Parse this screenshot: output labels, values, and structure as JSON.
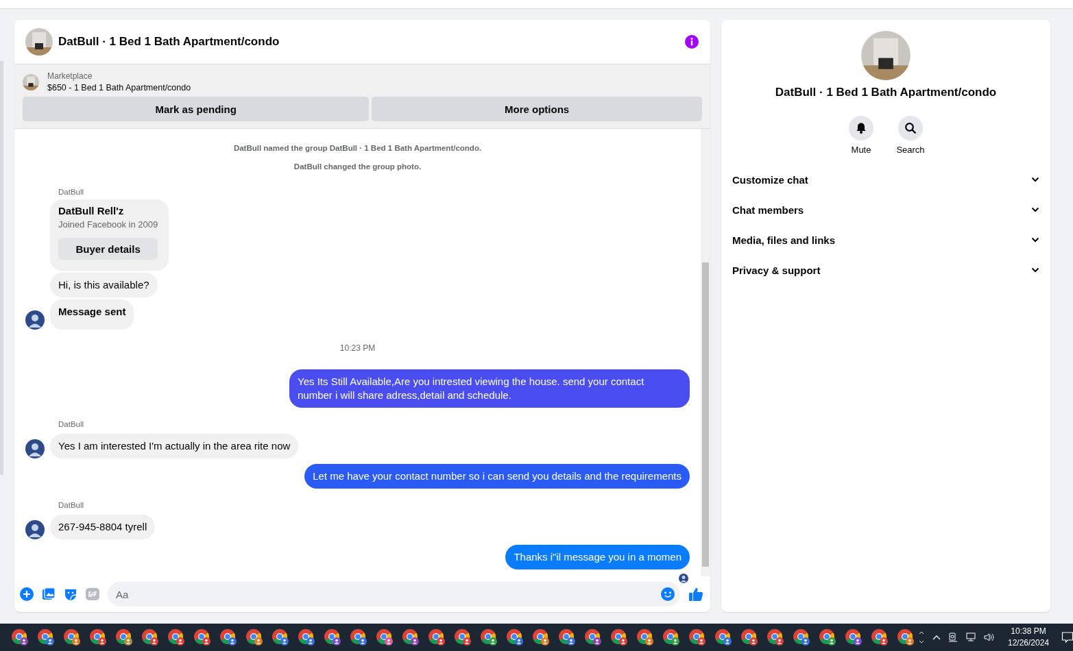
{
  "chat": {
    "title": "DatBull · 1 Bed 1 Bath Apartment/condo",
    "listing": {
      "label": "Marketplace",
      "text": "$650 - 1 Bed 1 Bath Apartment/condo"
    },
    "actions": [
      "Mark as pending",
      "More options"
    ],
    "messages": [
      {
        "kind": "event",
        "text": "DatBull named the group DatBull · 1 Bed 1 Bath Apartment/condo."
      },
      {
        "kind": "event",
        "text": "DatBull changed the group photo."
      },
      {
        "kind": "sender",
        "text": "DatBull"
      },
      {
        "kind": "card",
        "name": "DatBull Rell'z",
        "sub": "Joined Facebook in 2009",
        "button": "Buyer details"
      },
      {
        "kind": "incoming",
        "text": "Hi, is this available?",
        "avatar": false,
        "bold": false
      },
      {
        "kind": "incoming",
        "text": "Message sent",
        "avatar": true,
        "bold": true
      },
      {
        "kind": "time",
        "text": "10:23 PM"
      },
      {
        "kind": "outgoing",
        "text": "Yes Its Still Available,Are you intrested viewing the house. send your contact number i will share adress,detail and schedule.",
        "color": "#4a4ef0"
      },
      {
        "kind": "sender",
        "text": "DatBull"
      },
      {
        "kind": "incoming",
        "text": "Yes I am interested I'm actually in the area rite now",
        "avatar": true,
        "bold": false
      },
      {
        "kind": "outgoing",
        "text": "Let me have your contact number so i can send you details and the requirements",
        "color": "#2a5cf5"
      },
      {
        "kind": "sender",
        "text": "DatBull"
      },
      {
        "kind": "incoming",
        "text": "267-945-8804 tyrell",
        "avatar": true,
        "bold": false
      },
      {
        "kind": "outgoing",
        "text": "Thanks i\"il message you in a momen",
        "color": "#0a7cff"
      },
      {
        "kind": "seen"
      }
    ],
    "composer": {
      "placeholder": "Aa"
    }
  },
  "info": {
    "title": "DatBull · 1 Bed 1 Bath Apartment/condo",
    "buttons": [
      {
        "kind": "bell",
        "label": "Mute"
      },
      {
        "kind": "search",
        "label": "Search"
      }
    ],
    "sections": [
      {
        "label": "Customize chat",
        "expanded": false
      },
      {
        "label": "Chat members",
        "expanded": false
      },
      {
        "label": "Media, files and links",
        "expanded": false
      },
      {
        "label": "Privacy & support",
        "expanded": false
      }
    ]
  },
  "taskbar": {
    "apps": [
      {
        "color": "#8e44ad"
      },
      {
        "color": "#3a6fd8"
      },
      {
        "color": "#e07b24"
      },
      {
        "color": "#d9413a"
      },
      {
        "color": "#b08d3c"
      },
      {
        "color": "#d9413a"
      },
      {
        "color": "#d9413a"
      },
      {
        "color": "#d9413a"
      },
      {
        "color": "#3a6fd8"
      },
      {
        "color": "#e07b24"
      },
      {
        "color": "#3a6fd8"
      },
      {
        "color": "#3a6fd8"
      },
      {
        "color": "#7a4fd0"
      },
      {
        "color": "#3a6fd8"
      },
      {
        "color": "#e05aa0"
      },
      {
        "color": "#8e44ad"
      },
      {
        "color": "#d9413a"
      },
      {
        "color": "#d9413a"
      },
      {
        "color": "#3a9d4a"
      },
      {
        "color": "#3a6fd8"
      },
      {
        "color": "#e07b24"
      },
      {
        "color": "#3a6fd8"
      },
      {
        "color": "#8e44ad"
      },
      {
        "color": "#d9413a"
      },
      {
        "color": "#e07b24"
      },
      {
        "color": "#3a9d4a"
      },
      {
        "color": "#d9413a"
      },
      {
        "color": "#3a6fd8"
      },
      {
        "color": "#d9413a"
      },
      {
        "color": "#d9413a"
      },
      {
        "color": "#3a6fd8"
      },
      {
        "color": "#3a9d4a"
      },
      {
        "color": "#7a4fd0"
      },
      {
        "color": "#d9413a"
      },
      {
        "color": "#e07b24"
      }
    ],
    "time": "10:38 PM",
    "date": "12/26/2024"
  }
}
